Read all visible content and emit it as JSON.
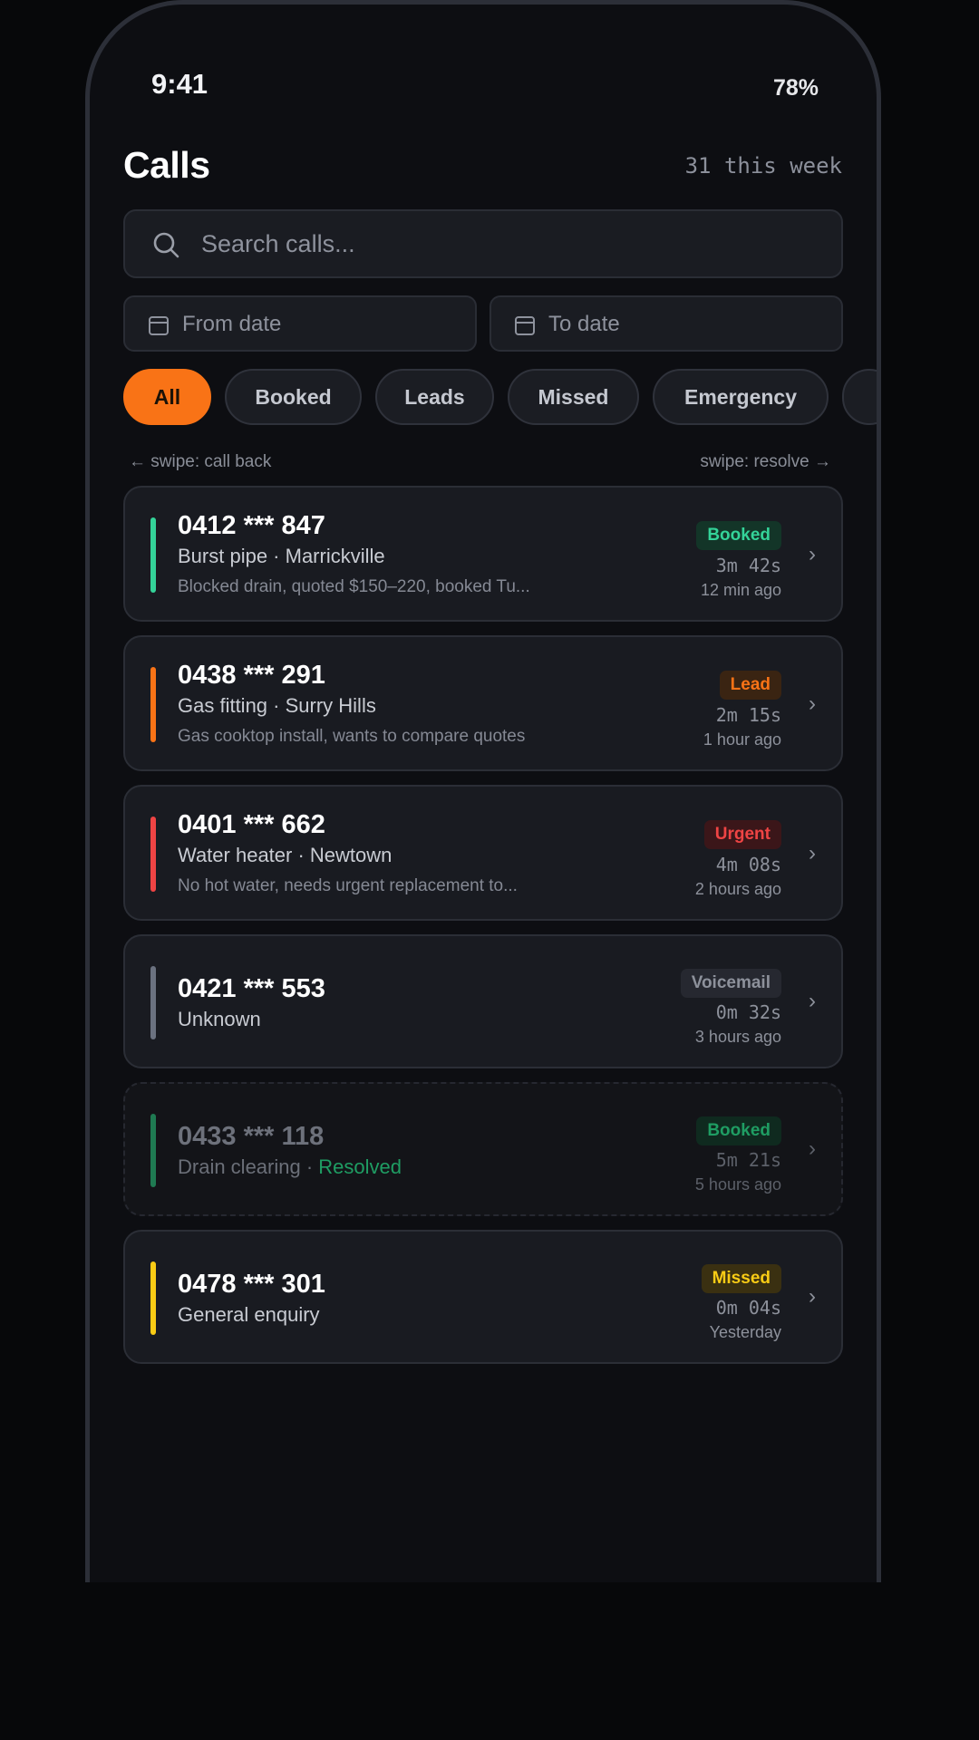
{
  "status": {
    "time": "9:41",
    "battery": "78%"
  },
  "header": {
    "title": "Calls",
    "week_count": "31 this week"
  },
  "search": {
    "placeholder": "Search calls..."
  },
  "date_filter": {
    "from_placeholder": "From date",
    "to_placeholder": "To date"
  },
  "filters": {
    "chips": [
      "All",
      "Booked",
      "Leads",
      "Missed",
      "Emergency"
    ],
    "active": "All"
  },
  "hints": {
    "left": "← swipe: call back",
    "right": "swipe: resolve →"
  },
  "colors": {
    "accent": "#f97316",
    "booked": "#34d399",
    "lead": "#f97316",
    "urgent": "#ef4444",
    "voicemail": "#6b7280",
    "missed": "#facc15"
  },
  "calls": [
    {
      "number": "0412 *** 847",
      "job": "Burst pipe",
      "location": "Marrickville",
      "summary": "Blocked drain, quoted $150–220, booked Tu...",
      "status": "Booked",
      "duration": "3m 42s",
      "time_ago": "12 min ago"
    },
    {
      "number": "0438 *** 291",
      "job": "Gas fitting",
      "location": "Surry Hills",
      "summary": "Gas cooktop install, wants to compare quotes",
      "status": "Lead",
      "duration": "2m 15s",
      "time_ago": "1 hour ago"
    },
    {
      "number": "0401 *** 662",
      "job": "Water heater",
      "location": "Newtown",
      "summary": "No hot water, needs urgent replacement to...",
      "status": "Urgent",
      "duration": "4m 08s",
      "time_ago": "2 hours ago"
    },
    {
      "number": "0421 *** 553",
      "job": "Unknown",
      "status": "Voicemail",
      "duration": "0m 32s",
      "time_ago": "3 hours ago"
    },
    {
      "number": "0433 *** 118",
      "job": "Drain clearing",
      "resolved_label": "Resolved",
      "status": "Booked",
      "duration": "5m 21s",
      "time_ago": "5 hours ago"
    },
    {
      "number": "0478 *** 301",
      "job": "General enquiry",
      "status": "Missed",
      "duration": "0m 04s",
      "time_ago": "Yesterday"
    }
  ]
}
